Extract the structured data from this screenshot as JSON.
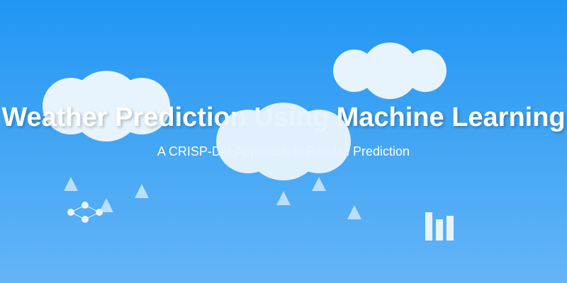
{
  "slide": {
    "title": "Weather Prediction Using Machine Learning",
    "subtitle": "A CRISP-DM Approach to Rainfall Prediction"
  },
  "colors": {
    "sky_top": "#2196f3",
    "sky_bottom": "#64b5f6",
    "cloud": "#e8f4fd",
    "raindrop": "#bbdefb",
    "text": "#ffffff"
  },
  "decorations": {
    "clouds": [
      "cloud-icon",
      "cloud-icon",
      "cloud-icon"
    ],
    "raindrops": [
      "raindrop-icon"
    ],
    "network": "neural-network-icon",
    "chart": "bar-chart-icon"
  }
}
